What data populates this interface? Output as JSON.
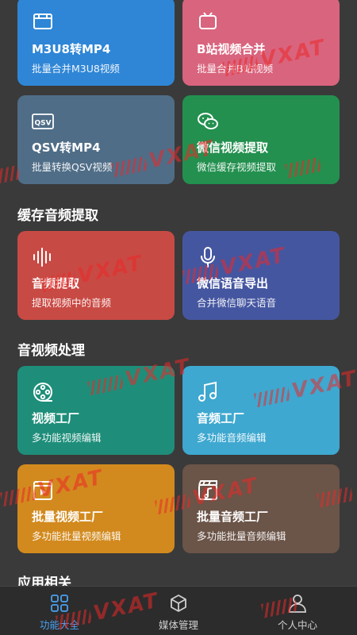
{
  "colors": {
    "background": "#3a3a3a",
    "navbar": "#2c2c2c",
    "active": "#4aa0f0",
    "inactive": "#cfcfcf"
  },
  "cards": [
    {
      "id": "m3u8",
      "title": "M3U8转MP4",
      "subtitle": "批量合并M3U8视频",
      "color": "#2f86d6",
      "icon": "film-icon"
    },
    {
      "id": "bilibili",
      "title": "B站视频合并",
      "subtitle": "批量合并B站视频",
      "color": "#d9647e",
      "icon": "tv-icon"
    },
    {
      "id": "qsv",
      "title": "QSV转MP4",
      "subtitle": "批量转换QSV视频",
      "color": "#4f6d87",
      "icon": "qsv-icon"
    },
    {
      "id": "wechat-video",
      "title": "微信视频提取",
      "subtitle": "微信缓存视频提取",
      "color": "#23904f",
      "icon": "wechat-icon"
    },
    {
      "id": "audio-extract",
      "title": "音频提取",
      "subtitle": "提取视频中的音频",
      "color": "#c84a44",
      "icon": "waveform-icon"
    },
    {
      "id": "wechat-voice",
      "title": "微信语音导出",
      "subtitle": "合并微信聊天语音",
      "color": "#4556a0",
      "icon": "microphone-icon"
    },
    {
      "id": "video-factory",
      "title": "视频工厂",
      "subtitle": "多功能视频编辑",
      "color": "#1e8e7a",
      "icon": "film-reel-icon"
    },
    {
      "id": "audio-factory",
      "title": "音频工厂",
      "subtitle": "多功能音频编辑",
      "color": "#3ea8d0",
      "icon": "music-note-icon"
    },
    {
      "id": "batch-video",
      "title": "批量视频工厂",
      "subtitle": "多功能批量视频编辑",
      "color": "#d28a1e",
      "icon": "video-play-icon"
    },
    {
      "id": "batch-audio",
      "title": "批量音频工厂",
      "subtitle": "多功能批量音频编辑",
      "color": "#6b5448",
      "icon": "clapper-music-icon"
    }
  ],
  "sections": {
    "cache_audio": "缓存音频提取",
    "av_processing": "音视频处理",
    "app_related": "应用相关"
  },
  "watermark_text": "VXAT",
  "nav": {
    "items": [
      {
        "label": "功能大全",
        "icon": "grid-icon",
        "active": true
      },
      {
        "label": "媒体管理",
        "icon": "cube-icon",
        "active": false
      },
      {
        "label": "个人中心",
        "icon": "person-icon",
        "active": false
      }
    ]
  }
}
